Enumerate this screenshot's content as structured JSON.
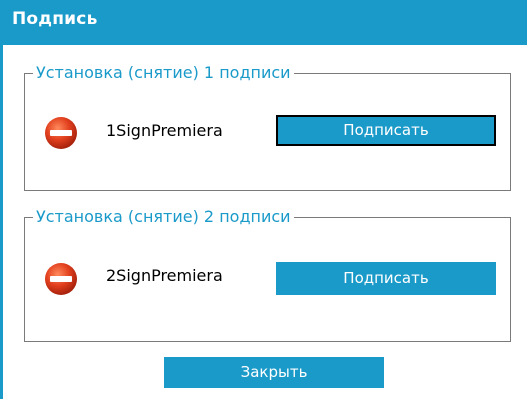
{
  "window": {
    "title": "Подпись"
  },
  "signatures": [
    {
      "legend": "Установка (снятие) 1 подписи",
      "label": "1SignPremiera",
      "button_label": "Подписать",
      "status_icon": "no-entry-icon"
    },
    {
      "legend": "Установка (снятие) 2 подписи",
      "label": "2SignPremiera",
      "button_label": "Подписать",
      "status_icon": "no-entry-icon"
    }
  ],
  "footer": {
    "close_label": "Закрыть"
  },
  "colors": {
    "accent": "#1a9ac9",
    "icon_red": "#d8361a",
    "group_border": "#7a7a7a"
  }
}
